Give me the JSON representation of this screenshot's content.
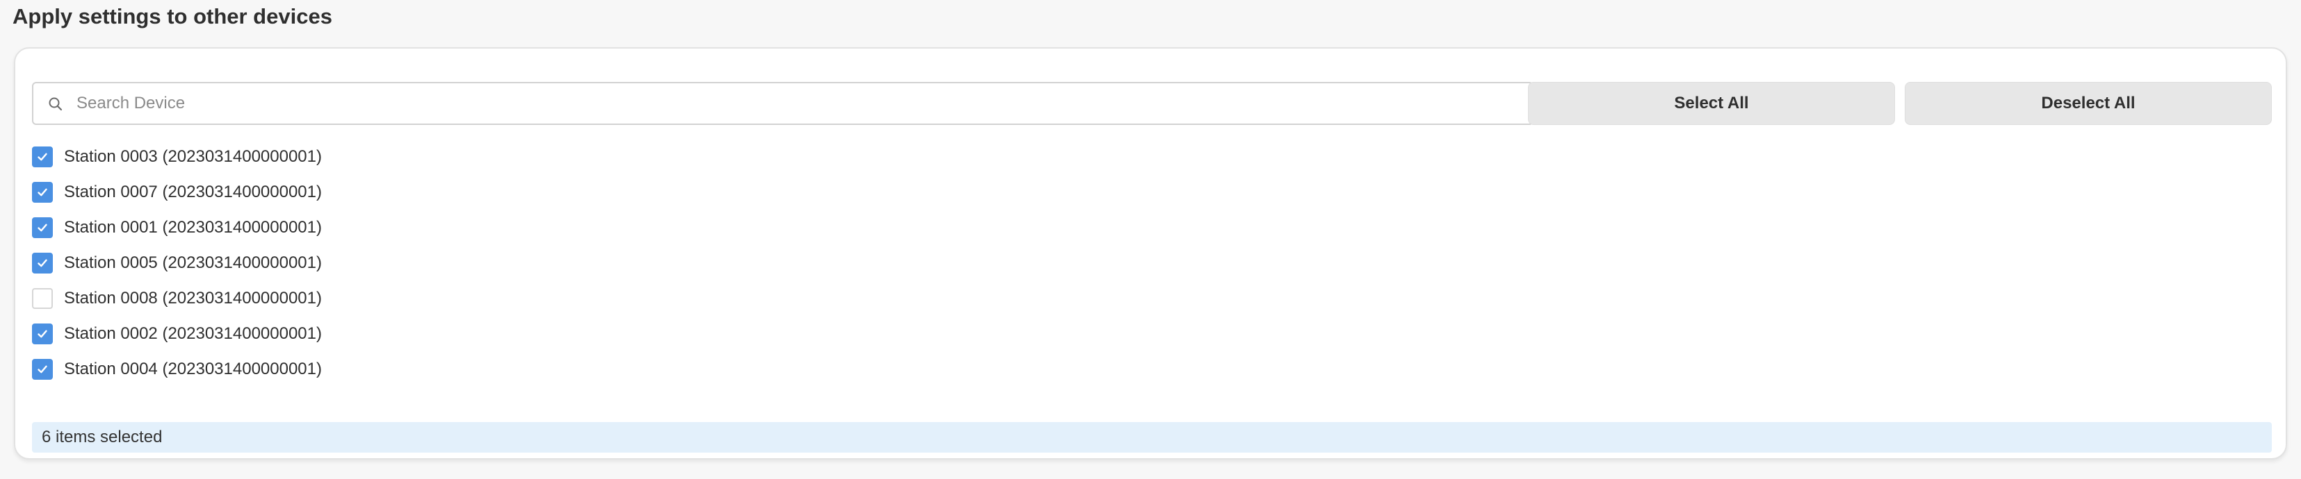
{
  "page": {
    "title": "Apply settings to other devices"
  },
  "search": {
    "placeholder": "Search Device",
    "value": ""
  },
  "actions": {
    "select_all_label": "Select All",
    "deselect_all_label": "Deselect All"
  },
  "devices": [
    {
      "label": "Station 0003 (2023031400000001)",
      "checked": true
    },
    {
      "label": "Station 0007 (2023031400000001)",
      "checked": true
    },
    {
      "label": "Station 0001 (2023031400000001)",
      "checked": true
    },
    {
      "label": "Station 0005 (2023031400000001)",
      "checked": true
    },
    {
      "label": "Station 0008 (2023031400000001)",
      "checked": false
    },
    {
      "label": "Station 0002 (2023031400000001)",
      "checked": true
    },
    {
      "label": "Station 0004 (2023031400000001)",
      "checked": true
    }
  ],
  "status": {
    "selected_text": "6 items selected"
  },
  "colors": {
    "accent": "#4a90e2",
    "status_bg": "#e3f0fb",
    "button_bg": "#e7e7e7"
  },
  "icons": {
    "search": "search-icon",
    "check": "checkmark-icon"
  }
}
